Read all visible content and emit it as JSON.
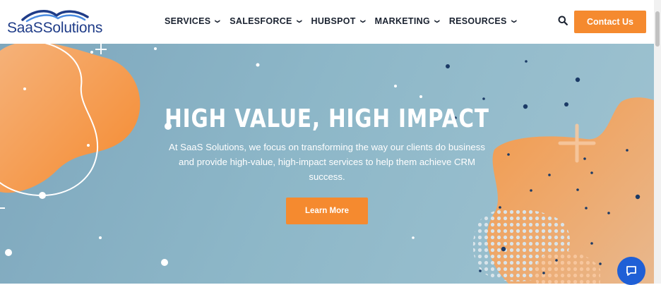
{
  "brand": {
    "logo_text": "SaaSSolutions"
  },
  "nav": {
    "items": [
      {
        "label": "SERVICES"
      },
      {
        "label": "SALESFORCE"
      },
      {
        "label": "HUBSPOT"
      },
      {
        "label": "MARKETING"
      },
      {
        "label": "RESOURCES"
      }
    ],
    "chevron": "⌄"
  },
  "header": {
    "contact_label": "Contact Us"
  },
  "hero": {
    "title": "HIGH VALUE, HIGH IMPACT",
    "subtitle": "At SaaS Solutions, we focus on transforming the way our clients do business and provide high-value, high-impact services to help them achieve CRM success.",
    "cta_label": "Learn More"
  },
  "colors": {
    "accent": "#f58a2f",
    "brand_blue": "#1f3c88",
    "hero_bg": "#8db7c8",
    "chat_blue": "#1f5fd6"
  },
  "icons": {
    "search": "search-icon",
    "chat": "chat-icon",
    "chevron": "chevron-down-icon"
  }
}
